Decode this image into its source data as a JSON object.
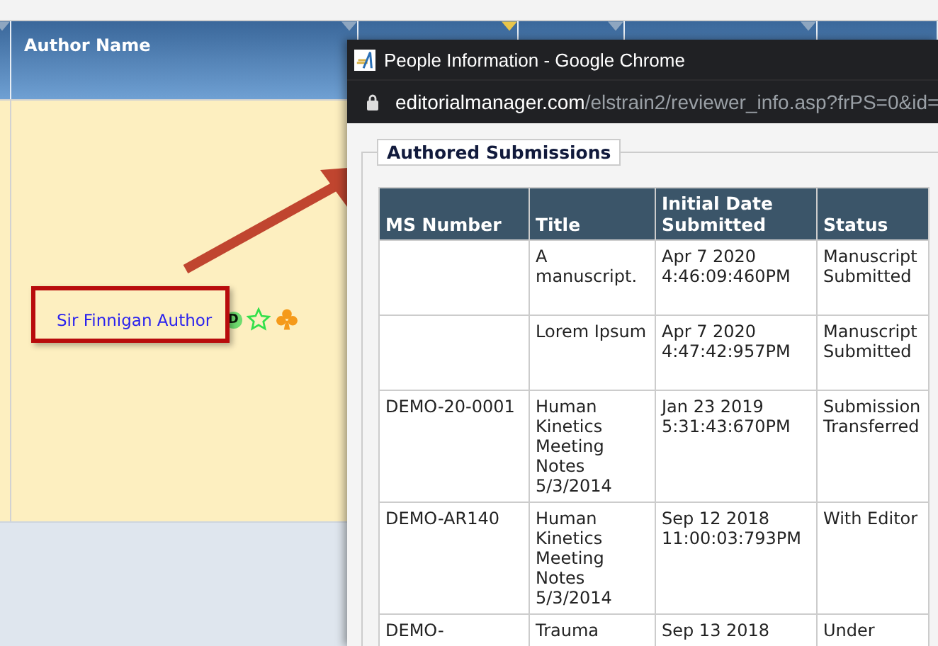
{
  "grid": {
    "columns": [
      {
        "filter_active": false
      },
      {
        "label": "Author Name",
        "filter_active": false
      },
      {
        "filter_active": true
      },
      {
        "filter_active": false
      },
      {
        "filter_active": false
      }
    ],
    "row": {
      "author": "Sir Finnigan Author",
      "badge": "D"
    }
  },
  "popup": {
    "title": "People Information - Google Chrome",
    "url_host": "editorialmanager.com",
    "url_path": "/elstrain2/reviewer_info.asp?frPS=0&id=",
    "section": "Authored Submissions",
    "table": {
      "columns": [
        "MS Number",
        "Title",
        "Initial Date Submitted",
        "Status"
      ],
      "rows": [
        [
          "",
          "A manuscript.",
          "Apr 7 2020 4:46:09:460PM",
          "Manuscript Submitted"
        ],
        [
          "",
          "Lorem Ipsum",
          "Apr 7 2020 4:47:42:957PM",
          "Manuscript Submitted"
        ],
        [
          "DEMO-20-0001",
          "Human Kinetics Meeting Notes 5/3/2014",
          "Jan 23 2019 5:31:43:670PM",
          "Submission Transferred"
        ],
        [
          "DEMO-AR140",
          "Human Kinetics Meeting Notes 5/3/2014",
          "Sep 12 2018 11:00:03:793PM",
          "With Editor"
        ],
        [
          "DEMO-",
          "Trauma",
          "Sep 13 2018",
          "Under"
        ]
      ]
    }
  }
}
